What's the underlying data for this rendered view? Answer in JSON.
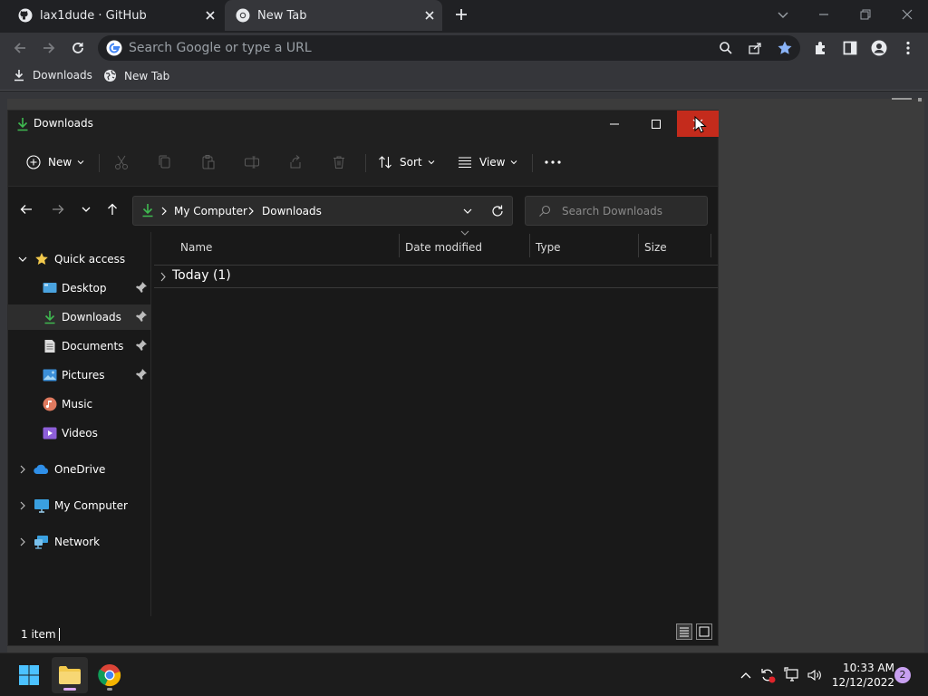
{
  "browser": {
    "tabs": [
      {
        "title": "lax1dude · GitHub",
        "icon": "github-icon"
      },
      {
        "title": "New Tab",
        "icon": "chrome-icon",
        "active": true
      }
    ],
    "omnibox_placeholder": "Search Google or type a URL",
    "bookmarks": [
      {
        "label": "Downloads",
        "icon": "download-icon"
      },
      {
        "label": "New Tab",
        "icon": "globe-icon"
      }
    ],
    "accent": "#8ab4f8"
  },
  "explorer": {
    "title": "Downloads",
    "command_bar": {
      "new_label": "New",
      "sort_label": "Sort",
      "view_label": "View"
    },
    "address": {
      "crumbs": [
        "My Computer",
        "Downloads"
      ]
    },
    "search_placeholder": "Search Downloads",
    "nav": {
      "quick_access": "Quick access",
      "items": [
        {
          "label": "Desktop",
          "icon": "desktop-icon",
          "pinned": true
        },
        {
          "label": "Downloads",
          "icon": "download-icon",
          "pinned": true,
          "selected": true
        },
        {
          "label": "Documents",
          "icon": "document-icon",
          "pinned": true
        },
        {
          "label": "Pictures",
          "icon": "pictures-icon",
          "pinned": true
        },
        {
          "label": "Music",
          "icon": "music-icon"
        },
        {
          "label": "Videos",
          "icon": "videos-icon"
        }
      ],
      "roots": [
        {
          "label": "OneDrive",
          "icon": "cloud-icon"
        },
        {
          "label": "My Computer",
          "icon": "computer-icon"
        },
        {
          "label": "Network",
          "icon": "network-icon"
        }
      ]
    },
    "columns": [
      "Name",
      "Date modified",
      "Type",
      "Size"
    ],
    "group_label": "Today (1)",
    "status": "1 item",
    "colors": {
      "close_red": "#c42b1c",
      "download_green": "#3fb950",
      "folder_yellow": "#f2c94c"
    }
  },
  "taskbar": {
    "time": "10:33 AM",
    "date": "12/12/2022",
    "notification_count": "2"
  }
}
